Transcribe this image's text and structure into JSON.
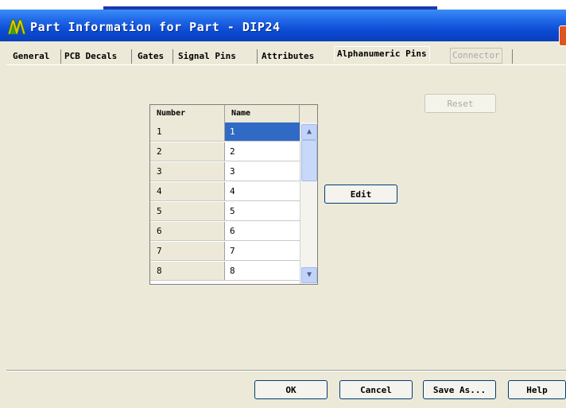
{
  "window": {
    "title": "Part Information for Part - DIP24",
    "icon": "app-logo-icon",
    "accent": "#0b49d2"
  },
  "tabs": [
    {
      "label": "General",
      "state": "normal"
    },
    {
      "label": "PCB Decals",
      "state": "normal"
    },
    {
      "label": "Gates",
      "state": "normal"
    },
    {
      "label": "Signal Pins",
      "state": "normal"
    },
    {
      "label": "Attributes",
      "state": "normal"
    },
    {
      "label": "Alphanumeric Pins",
      "state": "active"
    },
    {
      "label": "Connector",
      "state": "disabled"
    }
  ],
  "grid": {
    "columns": [
      "Number",
      "Name"
    ],
    "rows": [
      {
        "number": "1",
        "name": "1",
        "selected": true
      },
      {
        "number": "2",
        "name": "2"
      },
      {
        "number": "3",
        "name": "3"
      },
      {
        "number": "4",
        "name": "4"
      },
      {
        "number": "5",
        "name": "5"
      },
      {
        "number": "6",
        "name": "6"
      },
      {
        "number": "7",
        "name": "7"
      },
      {
        "number": "8",
        "name": "8"
      }
    ]
  },
  "buttons": {
    "reset": "Reset",
    "edit": "Edit",
    "ok": "OK",
    "cancel": "Cancel",
    "save_as": "Save As...",
    "help": "Help"
  }
}
